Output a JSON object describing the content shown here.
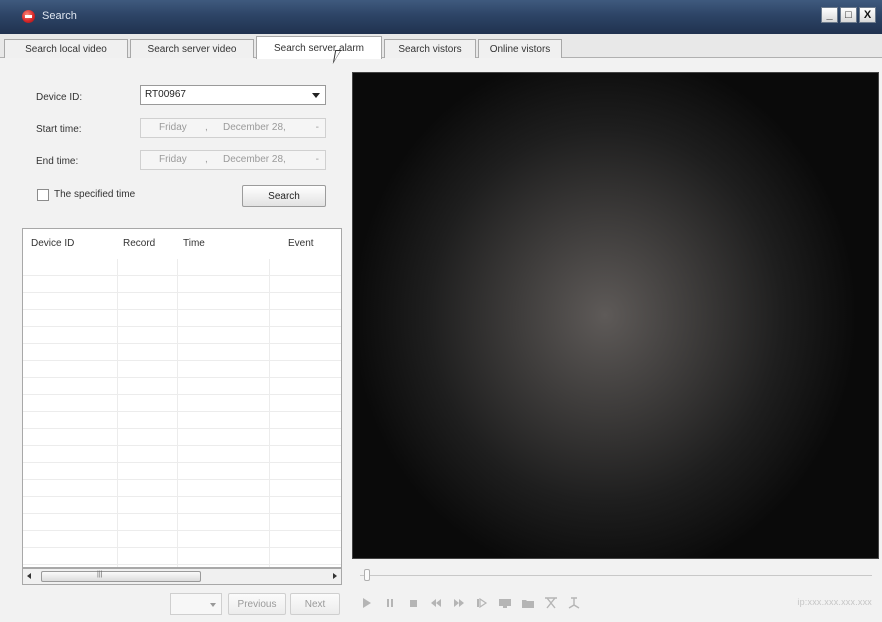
{
  "window": {
    "title": "Search",
    "buttons": {
      "minimize": "_",
      "maximize": "□",
      "close": "X"
    }
  },
  "tabs": [
    {
      "label": "Search local video"
    },
    {
      "label": "Search server video"
    },
    {
      "label": "Search server alarm",
      "active": true
    },
    {
      "label": "Search vistors"
    },
    {
      "label": "Online vistors"
    }
  ],
  "form": {
    "device_id_label": "Device ID:",
    "device_id_value": "RT00967",
    "start_time_label": "Start time:",
    "start_time": {
      "day": "Friday",
      "separator": ",",
      "month": "December  28,",
      "spin": "-"
    },
    "end_time_label": "End time:",
    "end_time": {
      "day": "Friday",
      "separator": ",",
      "month": "December  28,",
      "spin": "-"
    },
    "specified_time_label": "The specified time",
    "specified_time_checked": false,
    "search_button": "Search"
  },
  "table": {
    "columns": [
      "Device ID",
      "Record",
      "Time",
      "Event"
    ],
    "rows": []
  },
  "pager": {
    "page_value": "",
    "previous_label": "Previous",
    "next_label": "Next"
  },
  "player": {
    "progress": 0,
    "controls": [
      "play-icon",
      "pause-icon",
      "stop-icon",
      "rewind-icon",
      "fast-forward-icon",
      "step-forward-icon",
      "snapshot-icon",
      "folder-icon",
      "volume-icon",
      "voice-icon"
    ],
    "ip_text": "ip:xxx.xxx.xxx.xxx"
  },
  "colors": {
    "titlebar": "#2d4466",
    "video_background": "#0a0a0a",
    "control_icon": "#b5b5b5"
  }
}
